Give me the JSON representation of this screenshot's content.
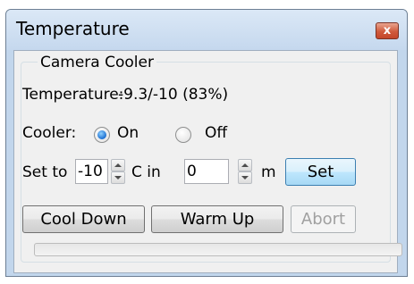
{
  "window": {
    "title": "Temperature",
    "close_glyph": "x"
  },
  "group": {
    "title": "Camera Cooler"
  },
  "temperature": {
    "label": "Temperature:",
    "value": "-9.3/-10 (83%)"
  },
  "cooler": {
    "label": "Cooler:",
    "options": [
      {
        "label": "On",
        "selected": true
      },
      {
        "label": "Off",
        "selected": false
      }
    ]
  },
  "setpoint": {
    "prefix": "Set to",
    "temp_value": "-10",
    "unit_label": "C in",
    "time_value": "0",
    "time_unit": "m",
    "set_button": "Set"
  },
  "actions": {
    "cool_down": "Cool Down",
    "warm_up": "Warm Up",
    "abort": "Abort"
  },
  "progress": {
    "value": 0
  },
  "colors": {
    "title_bar": "#c5d8ee",
    "close_button": "#d05a3c",
    "radio_selected": "#1b6fd1",
    "default_button": "#bee6fd"
  }
}
